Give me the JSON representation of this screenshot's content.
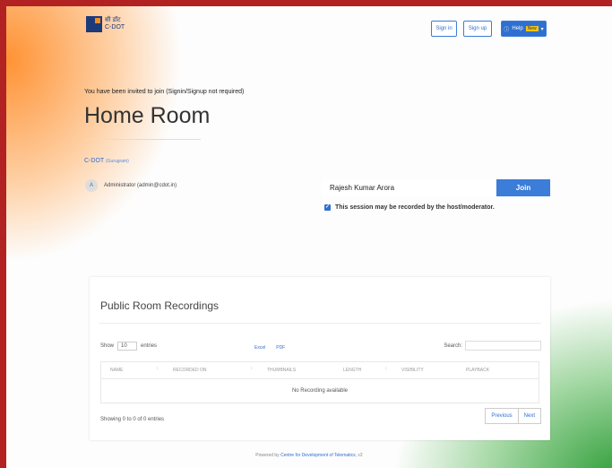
{
  "header": {
    "logo_hindi": "सी डॉट",
    "logo_english": "C-DOT",
    "signin_label": "Sign in",
    "signup_label": "Sign up",
    "help_label": "Help",
    "help_badge": "New",
    "help_caret": "▾"
  },
  "room": {
    "invite_text": "You have been invited to join (Signin/Signup not required)",
    "title": "Home Room",
    "org": "C-DOT",
    "org_sub": "(Gurugram)",
    "admin_initial": "A",
    "admin_label": "Administrator (admin@cdot.in)",
    "name_value": "Rajesh Kumar Arora",
    "join_label": "Join",
    "record_notice": "This session may be recorded by the host/moderator.",
    "record_checked": true
  },
  "recordings": {
    "title": "Public Room Recordings",
    "show_label": "Show",
    "entries_value": "10",
    "entries_label": "entries",
    "export_excel": "Excel",
    "export_pdf": "PDF",
    "search_label": "Search:",
    "columns": [
      "NAME",
      "RECORDED ON",
      "THUMBNAILS",
      "LENGTH",
      "VISIBILITY",
      "PLAYBACK"
    ],
    "empty_text": "No Recording available",
    "showing_text": "Showing 0 to 0 of 0 entries",
    "previous_label": "Previous",
    "next_label": "Next"
  },
  "footer": {
    "prefix": "Powered by",
    "link_text": "Centre for Development of Telematics",
    "suffix": ", v2"
  },
  "colors": {
    "accent": "#2f6fcf",
    "join_button": "#3b7dd8",
    "saffron": "#ff8c28",
    "green": "#1e9628",
    "frame": "#b22222"
  }
}
